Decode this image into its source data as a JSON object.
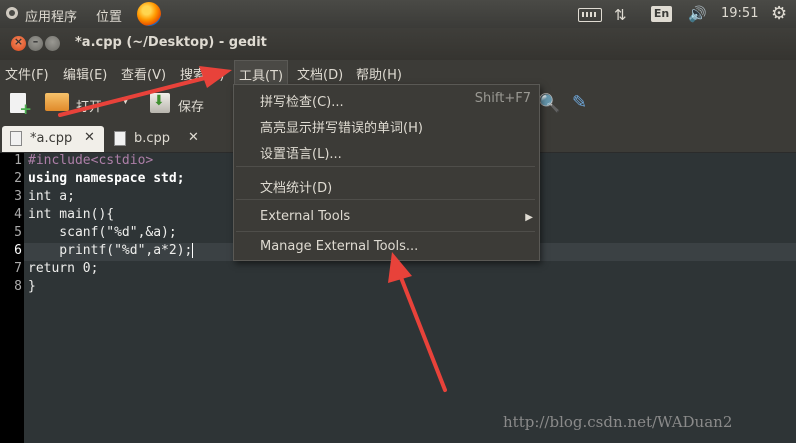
{
  "system_panel": {
    "apps_menu": "应用程序",
    "places_menu": "位置",
    "language": "En",
    "time": "19:51"
  },
  "window": {
    "title": "*a.cpp (~/Desktop) - gedit"
  },
  "menubar": {
    "items": [
      "文件(F)",
      "编辑(E)",
      "查看(V)",
      "搜索(S)",
      "工具(T)",
      "文档(D)",
      "帮助(H)"
    ]
  },
  "toolbar": {
    "open_label": "打开",
    "save_label": "保存"
  },
  "tabs": [
    {
      "label": "*a.cpp",
      "close": "✕",
      "active": true
    },
    {
      "label": "b.cpp",
      "close": "✕",
      "active": false
    }
  ],
  "editor": {
    "line_numbers": [
      "1",
      "2",
      "3",
      "4",
      "5",
      "6",
      "7",
      "8"
    ],
    "current_line": 6,
    "lines": [
      "#include<cstdio>",
      "using namespace std;",
      "int a;",
      "int main(){",
      "    scanf(\"%d\",&a);",
      "    printf(\"%d\",a*2);",
      "return 0;",
      "}"
    ]
  },
  "tools_menu": {
    "items": [
      {
        "label": "拼写检查(C)...",
        "accel": "Shift+F7"
      },
      {
        "label": "高亮显示拼写错误的单词(H)"
      },
      {
        "label": "设置语言(L)..."
      },
      {
        "label": "文档统计(D)"
      },
      {
        "label": "External Tools",
        "submenu": "▶"
      },
      {
        "label": "Manage External Tools..."
      }
    ]
  },
  "watermark": "http://blog.csdn.net/WADuan2",
  "colors": {
    "annotation_arrow": "#e8423a",
    "menu_bg": "#3c3b37",
    "editor_bg": "#2e3436",
    "close_button": "#e25a28"
  }
}
